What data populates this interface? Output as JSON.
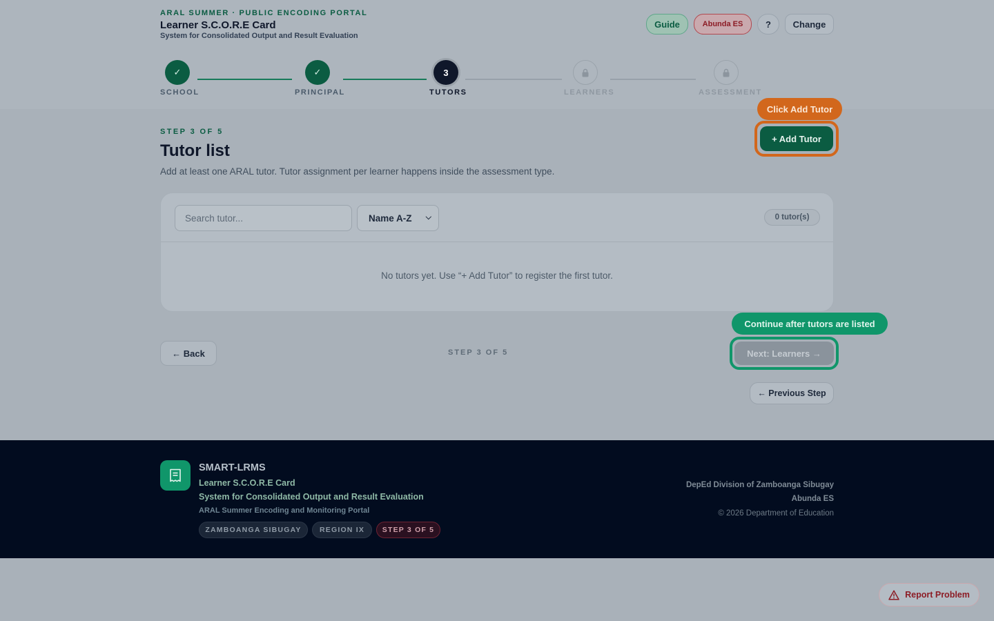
{
  "header": {
    "kicker": "ARAL SUMMER · PUBLIC ENCODING PORTAL",
    "title": "Learner S.C.O.R.E Card",
    "subtitle": "System for Consolidated Output and Result Evaluation",
    "buttons": {
      "guide": "Guide",
      "school": "Abunda ES",
      "help": "?",
      "change": "Change"
    }
  },
  "stepper": {
    "steps": [
      {
        "label": "SCHOOL",
        "status": "done",
        "marker": "✓"
      },
      {
        "label": "PRINCIPAL",
        "status": "done",
        "marker": "✓"
      },
      {
        "label": "TUTORS",
        "status": "current",
        "marker": "3"
      },
      {
        "label": "LEARNERS",
        "status": "locked",
        "marker": "lock-icon"
      },
      {
        "label": "ASSESSMENT",
        "status": "locked",
        "marker": "lock-icon"
      }
    ]
  },
  "main": {
    "step_kicker": "STEP 3 OF 5",
    "title": "Tutor list",
    "description": "Add at least one ARAL tutor. Tutor assignment per learner happens inside the assessment type.",
    "add_button": "+ Add Tutor",
    "callout_add": "Click Add Tutor",
    "search_placeholder": "Search tutor...",
    "sort_selected": "Name A-Z",
    "count": "0 tutor(s)",
    "empty_message": "No tutors yet. Use “+ Add Tutor” to register the first tutor.",
    "back_button": "← Back",
    "step_center": "STEP 3 OF 5",
    "callout_next": "Continue after tutors are listed",
    "next_button": "Next: Learners →",
    "previous_button": "← Previous Step"
  },
  "footer": {
    "brand": "SMART-LRMS",
    "title": "Learner S.C.O.R.E Card",
    "subtitle": "System for Consolidated Output and Result Evaluation",
    "portal": "ARAL Summer Encoding and Monitoring Portal",
    "chips": [
      "ZAMBOANGA SIBUGAY",
      "REGION IX",
      "STEP 3 OF 5"
    ],
    "division": "DepEd Division of Zamboanga Sibugay",
    "school": "Abunda ES",
    "copyright": "© 2026 Department of Education"
  },
  "report_button": "Report Problem",
  "colors": {
    "brand_green": "#0b5c42",
    "accent_orange": "#d2671c",
    "accent_green": "#10966a",
    "footer_bg": "#020c1f"
  }
}
